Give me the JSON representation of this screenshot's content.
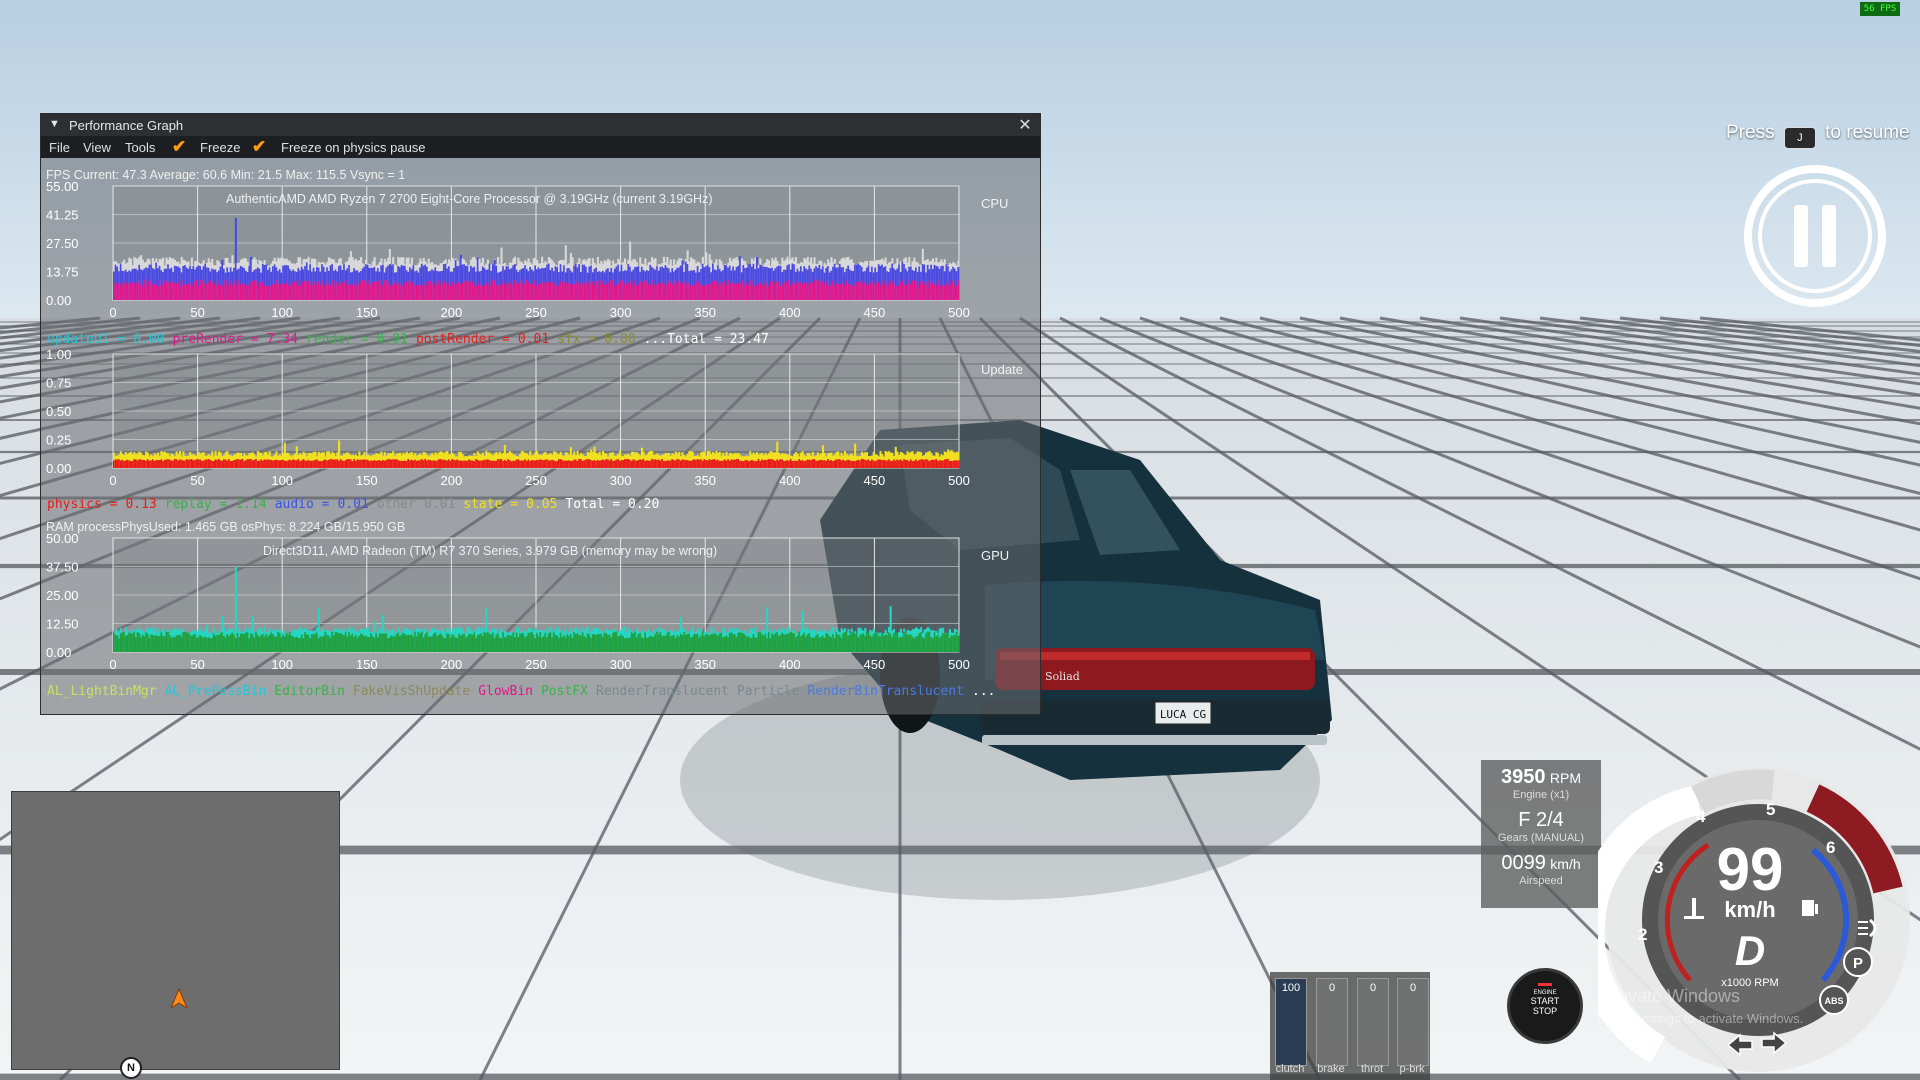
{
  "overlay": {
    "fps_counter": "56 FPS"
  },
  "resume": {
    "press": "Press",
    "key": "J",
    "to_resume": "to resume"
  },
  "perf_graph": {
    "title": "Performance Graph",
    "menu": [
      "File",
      "View",
      "Tools"
    ],
    "freeze_label": "Freeze",
    "freeze_physics_label": "Freeze on physics pause",
    "fps_line": "FPS  Current: 47.3  Average: 60.6  Min: 21.5  Max: 115.5 Vsync = 1",
    "x_ticks": [
      "0",
      "50",
      "100",
      "150",
      "200",
      "250",
      "300",
      "350",
      "400",
      "450",
      "500"
    ],
    "cpu": {
      "label": "CPU",
      "y_ticks": [
        "55.00",
        "41.25",
        "27.50",
        "13.75",
        "0.00"
      ],
      "info": "AuthenticAMD AMD Ryzen 7 2700 Eight-Core Processor         @ 3.19GHz (current 3.19GHz)",
      "legend": [
        {
          "text": "updateUI =",
          "color": "#25c4d6"
        },
        {
          "text": "0.00",
          "color": "#25c4d6"
        },
        {
          "text": "preRender =",
          "color": "#e0198a"
        },
        {
          "text": "7.34",
          "color": "#e0198a"
        },
        {
          "text": "render =",
          "color": "#3ab14a"
        },
        {
          "text": "0.01",
          "color": "#3ab14a"
        },
        {
          "text": "postRender =",
          "color": "#e81c1c"
        },
        {
          "text": "0.01",
          "color": "#e81c1c"
        },
        {
          "text": "sfx =",
          "color": "#8a8a2a"
        },
        {
          "text": "0.00",
          "color": "#8a8a2a"
        },
        {
          "text": "...Total = 23.47",
          "color": "#ffffff"
        }
      ]
    },
    "update": {
      "label": "Update",
      "y_ticks": [
        "1.00",
        "0.75",
        "0.50",
        "0.25",
        "0.00"
      ],
      "legend": [
        {
          "text": "physics =",
          "color": "#e81c1c"
        },
        {
          "text": "0.13",
          "color": "#e81c1c"
        },
        {
          "text": "replay =",
          "color": "#3ab14a"
        },
        {
          "text": "1.14",
          "color": "#3ab14a"
        },
        {
          "text": "audio =",
          "color": "#3b55e6"
        },
        {
          "text": "0.01",
          "color": "#3b55e6"
        },
        {
          "text": "other",
          "color": "#8a8a8a"
        },
        {
          "text": "0.01",
          "color": "#8a8a8a"
        },
        {
          "text": "state =",
          "color": "#f0e020"
        },
        {
          "text": "0.05",
          "color": "#f0e020"
        },
        {
          "text": "Total = 0.20",
          "color": "#ffffff"
        }
      ]
    },
    "ram_line": "RAM  processPhysUsed: 1.465 GB  osPhys: 8.224 GB/15.950 GB",
    "gpu": {
      "label": "GPU",
      "y_ticks": [
        "50.00",
        "37.50",
        "25.00",
        "12.50",
        "0.00"
      ],
      "info": "Direct3D11, AMD Radeon (TM) R7 370 Series, 3.979 GB (memory may be wrong)",
      "legend": [
        {
          "text": "AL_LightBinMgr",
          "color": "#c8e060"
        },
        {
          "text": "AL_PrePassBin",
          "color": "#25c4d6"
        },
        {
          "text": "EditorBin",
          "color": "#3ab14a"
        },
        {
          "text": "FakeVisShUpdate",
          "color": "#8a8a5a"
        },
        {
          "text": "GlowBin",
          "color": "#e0198a"
        },
        {
          "text": "PostFX",
          "color": "#3ab14a"
        },
        {
          "text": "RenderTranslucent Particle",
          "color": "#7a8a8a"
        },
        {
          "text": "RenderBinTranslucent",
          "color": "#4a7ae0"
        },
        {
          "text": "...",
          "color": "#ffffff"
        }
      ]
    }
  },
  "dashboard": {
    "rpm": "3950",
    "rpm_unit": "RPM",
    "engine_label": "Engine (x1)",
    "gear": "F 2/4",
    "gear_label": "Gears (MANUAL)",
    "airspeed": "0099",
    "airspeed_unit": "km/h",
    "airspeed_label": "Airspeed",
    "speed": "99",
    "speed_unit": "km/h",
    "drive_mode": "D",
    "rpm_scale_label": "x1000 RPM",
    "gauge_numbers": [
      "2",
      "3",
      "4",
      "5",
      "6"
    ],
    "park_label": "P",
    "abs_label": "ABS"
  },
  "pedals": [
    {
      "label": "clutch",
      "value": "100",
      "level": 1.0
    },
    {
      "label": "brake",
      "value": "0",
      "level": 0
    },
    {
      "label": "throt",
      "value": "0",
      "level": 0
    },
    {
      "label": "p-brk",
      "value": "0",
      "level": 0
    }
  ],
  "engine_button": {
    "line1": "ENGINE",
    "line2": "START",
    "line3": "STOP"
  },
  "minimap": {
    "north": "N"
  },
  "car": {
    "plate": "LUCA CG",
    "badge": "Soliad"
  },
  "watermark": {
    "title": "Activate Windows",
    "sub": "Go to Settings to activate Windows."
  },
  "colors": {
    "sky": "#c9dbe8",
    "floor": "#dfe6ea",
    "grid": "#4a4d52",
    "car_body": "#1d3d4a",
    "accent": "#ff9a1a"
  }
}
